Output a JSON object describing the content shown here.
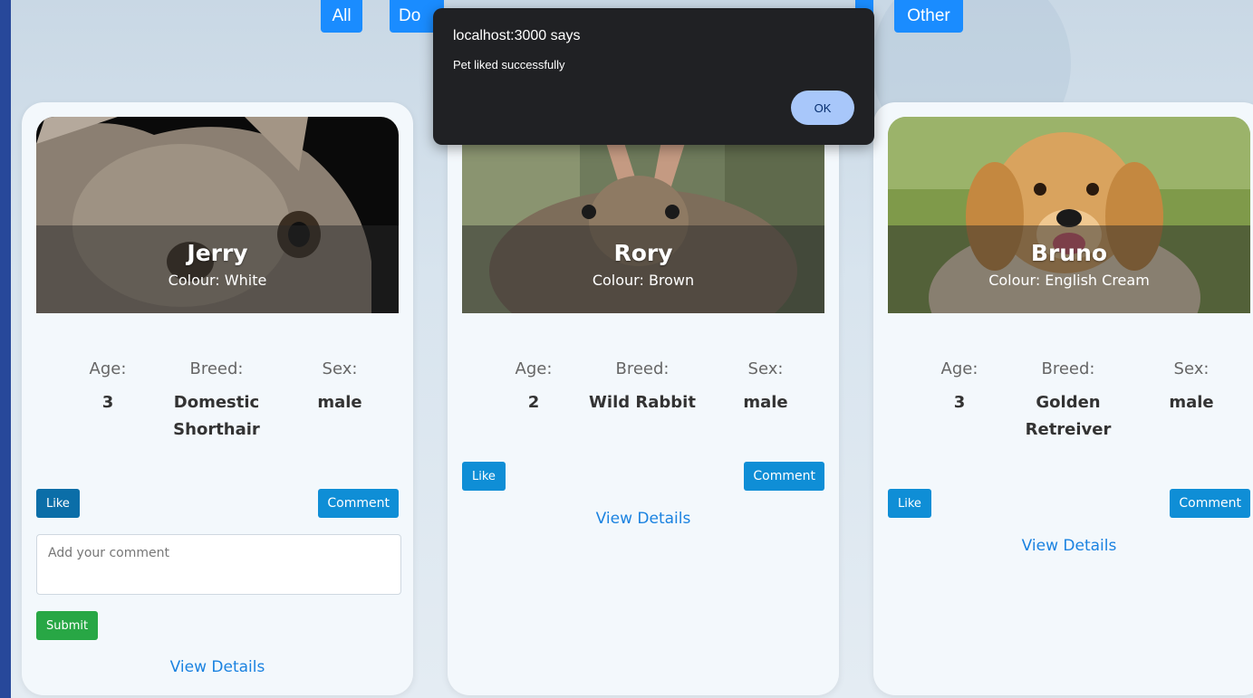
{
  "filters": [
    "All",
    "Do",
    "Other"
  ],
  "dialog": {
    "title": "localhost:3000 says",
    "message": "Pet liked successfully",
    "ok_label": "OK"
  },
  "labels": {
    "age": "Age:",
    "breed": "Breed:",
    "sex": "Sex:",
    "like": "Like",
    "comment": "Comment",
    "submit": "Submit",
    "view_details": "View Details",
    "comment_placeholder": "Add your comment"
  },
  "pets": [
    {
      "name": "Jerry",
      "colour": "Colour: White",
      "age": "3",
      "breed": "Domestic Shorthair",
      "sex": "male"
    },
    {
      "name": "Rory",
      "colour": "Colour: Brown",
      "age": "2",
      "breed": "Wild Rabbit",
      "sex": "male"
    },
    {
      "name": "Bruno",
      "colour": "Colour: English Cream",
      "age": "3",
      "breed": "Golden Retreiver",
      "sex": "male"
    }
  ],
  "colors": {
    "primary_button": "#0f8ed6",
    "submit_button": "#28a745",
    "link": "#1a82e0",
    "dialog_bg": "#202124",
    "dialog_ok": "#a8c7fa"
  }
}
